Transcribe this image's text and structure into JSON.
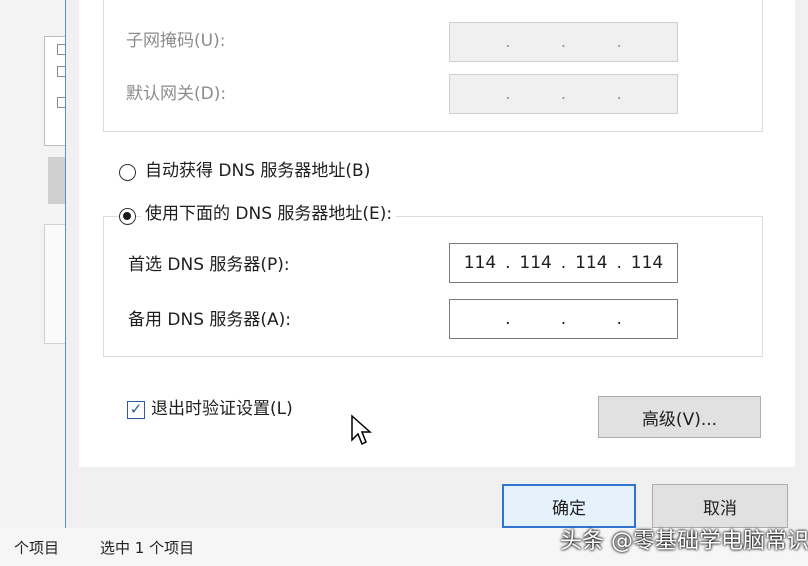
{
  "ip_section": {
    "subnet_label": "子网掩码(U):",
    "gateway_label": "默认网关(D):",
    "subnet_value": [
      "",
      "",
      "",
      ""
    ],
    "gateway_value": [
      "",
      "",
      "",
      ""
    ]
  },
  "dns_section": {
    "auto_radio_label": "自动获得 DNS 服务器地址(B)",
    "manual_radio_label": "使用下面的 DNS 服务器地址(E):",
    "selected": "manual",
    "preferred_label": "首选 DNS 服务器(P):",
    "preferred_value": [
      "114",
      "114",
      "114",
      "114"
    ],
    "alternate_label": "备用 DNS 服务器(A):",
    "alternate_value": [
      "",
      "",
      "",
      ""
    ]
  },
  "validate_checkbox": {
    "label": "退出时验证设置(L)",
    "checked": true
  },
  "buttons": {
    "advanced": "高级(V)...",
    "ok": "确定",
    "cancel": "取消"
  },
  "status_bar": {
    "items_count": "个项目",
    "selected_text": "选中 1 个项目"
  },
  "watermark": "头条 @零基础学电脑常识",
  "colors": {
    "accent": "#2f74d0",
    "dialog_bg": "#f0f0f0",
    "disabled_text": "#8c8c8c"
  }
}
